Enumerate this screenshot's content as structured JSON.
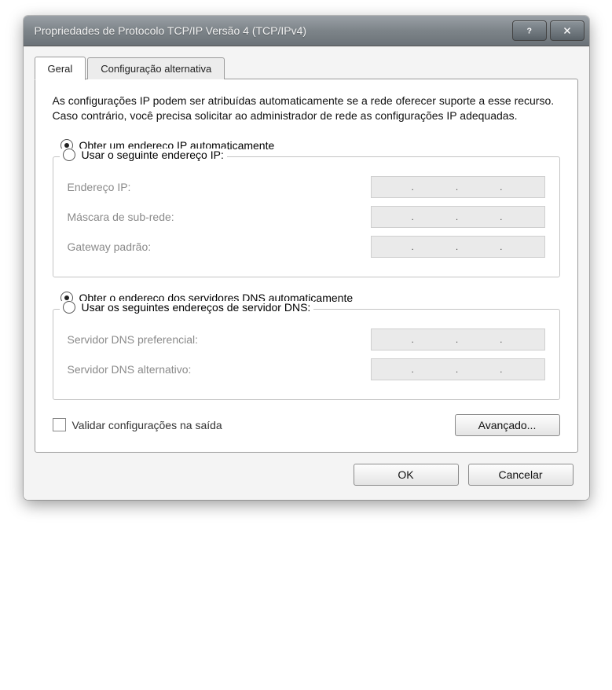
{
  "titlebar": {
    "title": "Propriedades de Protocolo TCP/IP Versão 4 (TCP/IPv4)"
  },
  "tabs": {
    "general": "Geral",
    "alt": "Configuração alternativa"
  },
  "description": "As configurações IP podem ser atribuídas automaticamente se a rede oferecer suporte a esse recurso. Caso contrário, você precisa solicitar ao administrador de rede as configurações IP adequadas.",
  "ip": {
    "auto": "Obter um endereço IP automaticamente",
    "manual": "Usar o seguinte endereço IP:",
    "addr": "Endereço IP:",
    "mask": "Máscara de sub-rede:",
    "gw": "Gateway padrão:"
  },
  "dns": {
    "auto": "Obter o endereço dos servidores DNS automaticamente",
    "manual": "Usar os seguintes endereços de servidor DNS:",
    "pref": "Servidor DNS preferencial:",
    "alt": "Servidor DNS alternativo:"
  },
  "validate": "Validar configurações na saída",
  "advanced": "Avançado...",
  "ok": "OK",
  "cancel": "Cancelar"
}
